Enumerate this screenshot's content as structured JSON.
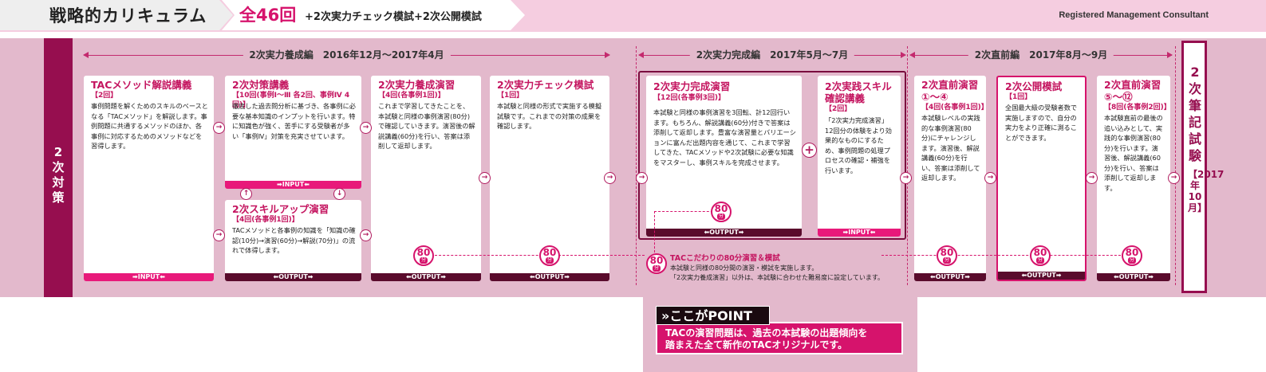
{
  "header": {
    "title": "戦略的カリキュラム",
    "total": "全46回",
    "subtitle": "+2次実力チェック模試+2次公開模試",
    "right_label": "Registered Management Consultant"
  },
  "left_label": "2次対策",
  "exam": {
    "title": "2次筆記試験",
    "date": "【2017年10月】"
  },
  "phases": {
    "p1": "2次実力養成編　2016年12月〜2017年4月",
    "p2": "2次実力完成編　2017年5月〜7月",
    "p3": "2次直前編　2017年8月〜9月"
  },
  "boxes": {
    "tac": {
      "title": "TACメソッド解説講義",
      "sub": "【2回】",
      "desc": "事例問題を解くためのスキルのベースとなる「TACメソッド」を解説します。事例問題に共通するメソッドのほか、各事例に対応するためのメソッドなどを習得します。",
      "strip": "➡INPUT⬅"
    },
    "taisaku": {
      "title": "2次対策講義",
      "sub": "【10回(事例Ⅰ〜Ⅲ 各2回、事例Ⅳ 4回)】",
      "desc": "徹底した過去問分析に基づき、各事例に必要な基本知識のインプットを行います。特に知識色が強く、苦手にする受験者が多い「事例Ⅳ」対策を充実させています。",
      "strip": "➡INPUT⬅"
    },
    "skillup": {
      "title": "2次スキルアップ演習",
      "sub": "【4回(各事例1回)】",
      "desc": "TACメソッドと各事例の知識を「知識の確認(10分)→演習(60分)→解説(70分)」の流れで体得します。",
      "strip": "⬅OUTPUT➡"
    },
    "yosei": {
      "title": "2次実力養成演習",
      "sub": "【4回(各事例1回)】",
      "desc": "これまで学習してきたことを、本試験と同様の事例演習(80分)で確認していきます。演習後の解説講義(60分)を行い、答案は添削して返却します。",
      "strip": "⬅OUTPUT➡"
    },
    "check": {
      "title": "2次実力チェック模試",
      "sub": "【1回】",
      "desc": "本試験と同様の形式で実施する模擬試験です。これまでの対策の成果を確認します。",
      "strip": "⬅OUTPUT➡"
    },
    "kansei": {
      "title": "2次実力完成演習",
      "sub": "【12回(各事例3回)】",
      "desc": "本試験と同様の事例演習を3回転、計12回行います。もちろん、解説講義(60分)付きで答案は添削して返却します。豊富な演習量とバリエーションに富んだ出題内容を通じて、これまで学習してきた、TACメソッドや2次試験に必要な知識をマスターし、事例スキルを完成させます。",
      "strip": "⬅OUTPUT➡"
    },
    "jissen": {
      "title": "2次実践スキル確認講義",
      "sub": "【2回】",
      "desc": "「2次実力完成演習」12回分の体験をより効果的なものにするため、事例問題の処理プロセスの確認・補強を行います。",
      "strip": "➡INPUT⬅"
    },
    "chokuzen1": {
      "title": "2次直前演習①〜④",
      "sub": "【4回(各事例1回)】",
      "desc": "本試験レベルの実践的な事例演習(80分)にチャレンジします。演習後、解説講義(60分)を行い、答案は添削して返却します。",
      "strip": "⬅OUTPUT➡"
    },
    "koukai": {
      "title": "2次公開模試",
      "sub": "【1回】",
      "desc": "全国最大級の受験者数で実施しますので、自分の実力をより正確に測ることができます。",
      "strip": "⬅OUTPUT➡"
    },
    "chokuzen2": {
      "title": "2次直前演習⑤〜⑫",
      "sub": "【8回(各事例2回)】",
      "desc": "本試験直前の最後の追い込みとして、実践的な事例演習(80分)を行います。演習後、解説講義(60分)を行い、答案は添削して返却します。",
      "strip": "⬅OUTPUT➡"
    }
  },
  "badge": {
    "num": "80",
    "unit": "分"
  },
  "note": {
    "title": "TACこだわりの80分演習＆模試",
    "line1": "本試験と同様の80分間の演習・模試を実施します。",
    "line2": "「2次実力養成演習」以外は、本試験に合わせた難易度に設定しています。"
  },
  "point": {
    "tag": "»ここがPOINT",
    "line1": "TACの演習問題は、過去の本試験の出題傾向を",
    "line2": "踏まえた全て新作のTACオリジナルです。"
  },
  "icons": {
    "arrow_right": "→",
    "arrow_up": "↑",
    "arrow_down": "↓",
    "plus": "+"
  },
  "colors": {
    "accent": "#d6136c",
    "dark": "#960e4f",
    "band": "#e3b9cc",
    "output": "#5a0b2c"
  }
}
